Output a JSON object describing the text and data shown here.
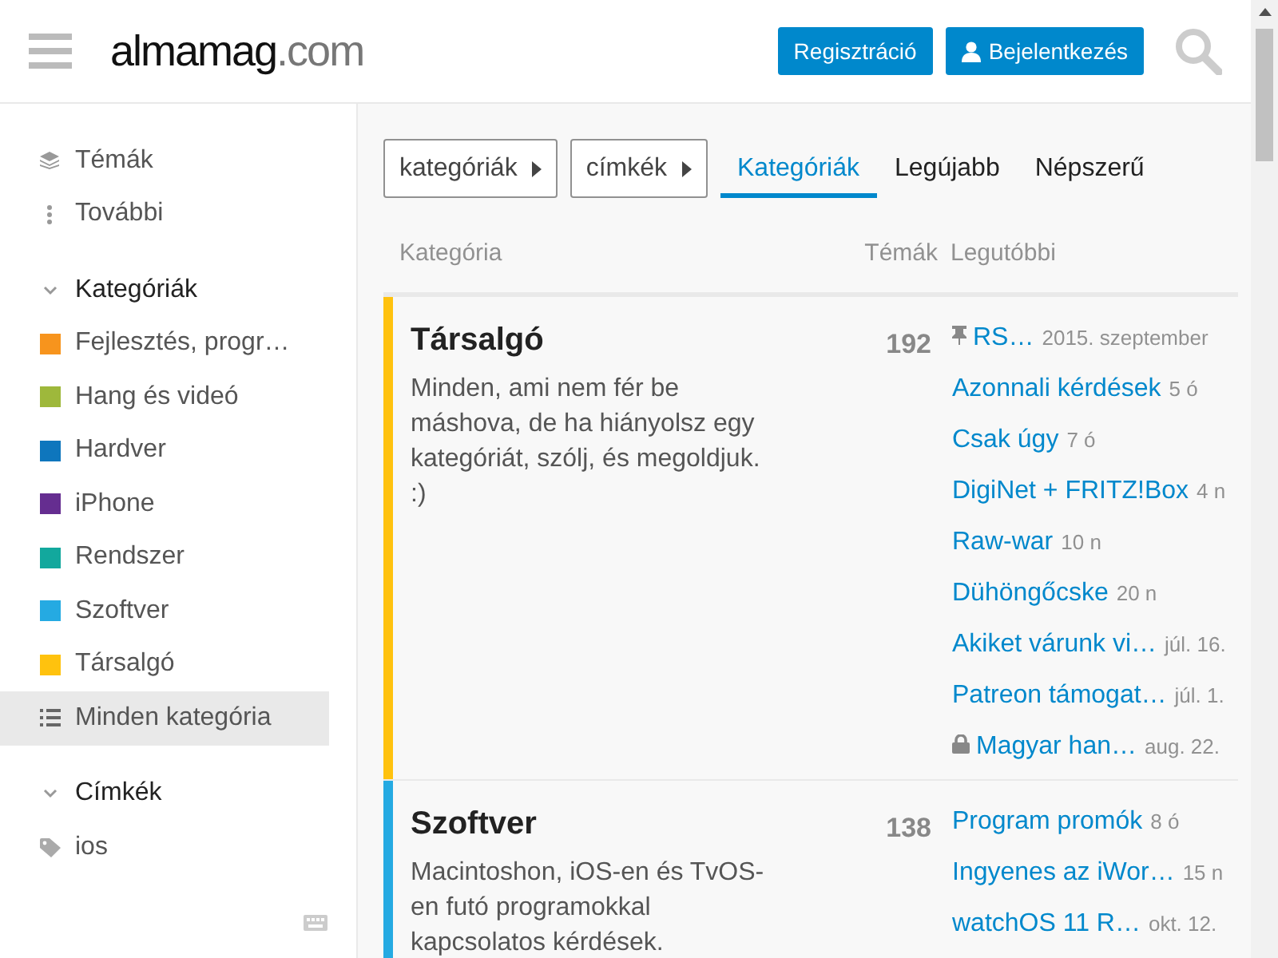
{
  "header": {
    "logo_main": "almamag",
    "logo_suffix": ".com",
    "buttons": [
      {
        "label": "Regisztráció",
        "kind": "plain"
      },
      {
        "label": "Bejelentkezés",
        "kind": "user"
      }
    ]
  },
  "sidebar": {
    "top_items": [
      {
        "label": "Témák",
        "kind": "layers"
      },
      {
        "label": "További",
        "kind": "more"
      }
    ],
    "sections": [
      {
        "title": "Kategóriák",
        "expanded": true,
        "items": [
          {
            "label": "Fejlesztés, progr…",
            "kind": "swatch",
            "color": "#f7941d",
            "selected": false
          },
          {
            "label": "Hang és videó",
            "kind": "swatch",
            "color": "#9eb83b",
            "selected": false
          },
          {
            "label": "Hardver",
            "kind": "swatch",
            "color": "#0e76bd",
            "selected": false
          },
          {
            "label": "iPhone",
            "kind": "swatch",
            "color": "#652d90",
            "selected": false
          },
          {
            "label": "Rendszer",
            "kind": "swatch",
            "color": "#12a89d",
            "selected": false
          },
          {
            "label": "Szoftver",
            "kind": "swatch",
            "color": "#25aae2",
            "selected": false
          },
          {
            "label": "Társalgó",
            "kind": "swatch",
            "color": "#ffc20e",
            "selected": false
          },
          {
            "label": "Minden kategória",
            "kind": "list",
            "selected": true
          }
        ]
      },
      {
        "title": "Címkék",
        "expanded": true,
        "items": [
          {
            "label": "ios",
            "kind": "tag",
            "selected": false
          }
        ]
      }
    ]
  },
  "filters": [
    {
      "label": "kategóriák"
    },
    {
      "label": "címkék"
    }
  ],
  "tabs": [
    {
      "label": "Kategóriák",
      "selected": true
    },
    {
      "label": "Legújabb",
      "selected": false
    },
    {
      "label": "Népszerű",
      "selected": false
    }
  ],
  "table": {
    "columns": [
      "Kategória",
      "Témák",
      "Legutóbbi"
    ],
    "rows": [
      {
        "name": "Társalgó",
        "color": "#ffc20e",
        "count": "192",
        "description": "Minden, ami nem fér be máshova, de ha hiányolsz egy kategóriát, szólj, és megoldjuk. :)",
        "topics": [
          {
            "title": "RS…",
            "age": "2015. szeptember",
            "kind": "pinned"
          },
          {
            "title": "Azonnali kérdések",
            "age": "5 ó",
            "kind": "normal"
          },
          {
            "title": "Csak úgy",
            "age": "7 ó",
            "kind": "normal"
          },
          {
            "title": "DigiNet + FRITZ!Box",
            "age": "4 n",
            "kind": "normal"
          },
          {
            "title": "Raw-war",
            "age": "10 n",
            "kind": "normal"
          },
          {
            "title": "Dühöngőcske",
            "age": "20 n",
            "kind": "normal"
          },
          {
            "title": "Akiket várunk vi…",
            "age": "júl. 16.",
            "kind": "normal"
          },
          {
            "title": "Patreon támogat…",
            "age": "júl. 1.",
            "kind": "normal"
          },
          {
            "title": "Magyar han…",
            "age": "aug. 22.",
            "kind": "locked"
          }
        ]
      },
      {
        "name": "Szoftver",
        "color": "#25aae2",
        "count": "138",
        "description": "Macintoshon, iOS-en és TvOS-en futó programokkal kapcsolatos kérdések.",
        "topics": [
          {
            "title": "Program promók",
            "age": "8 ó",
            "kind": "normal"
          },
          {
            "title": "Ingyenes az iWor…",
            "age": "15 n",
            "kind": "normal"
          },
          {
            "title": "watchOS 11 R…",
            "age": "okt. 12.",
            "kind": "normal"
          }
        ]
      }
    ]
  }
}
